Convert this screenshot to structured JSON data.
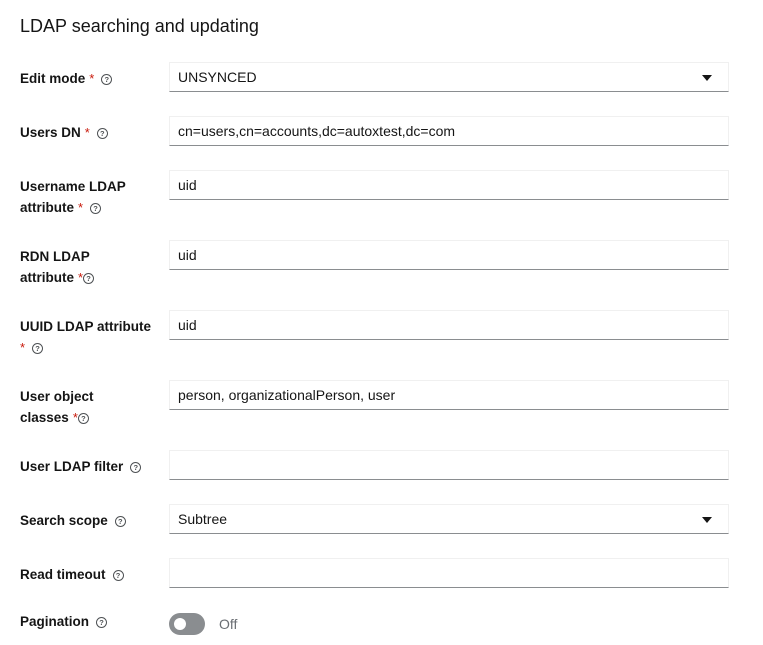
{
  "section_title": "LDAP searching and updating",
  "required_mark": "*",
  "help_glyph": "?",
  "fields": {
    "edit_mode": {
      "label": "Edit mode",
      "value": "UNSYNCED"
    },
    "users_dn": {
      "label": "Users DN",
      "value": "cn=users,cn=accounts,dc=autoxtest,dc=com"
    },
    "username_attr": {
      "label": "Username LDAP attribute",
      "value": "uid"
    },
    "rdn_attr": {
      "label": "RDN LDAP attribute",
      "value": "uid"
    },
    "uuid_attr": {
      "label": "UUID LDAP attribute",
      "value": "uid"
    },
    "object_classes": {
      "label": "User object classes",
      "value": "person, organizationalPerson, user"
    },
    "ldap_filter": {
      "label": "User LDAP filter",
      "value": ""
    },
    "search_scope": {
      "label": "Search scope",
      "value": "Subtree"
    },
    "read_timeout": {
      "label": "Read timeout",
      "value": ""
    },
    "pagination": {
      "label": "Pagination",
      "state": "Off",
      "enabled": false
    }
  },
  "colors": {
    "required": "#c9190b",
    "toggle_off": "#8a8d90",
    "input_border": "#8a8d90"
  }
}
